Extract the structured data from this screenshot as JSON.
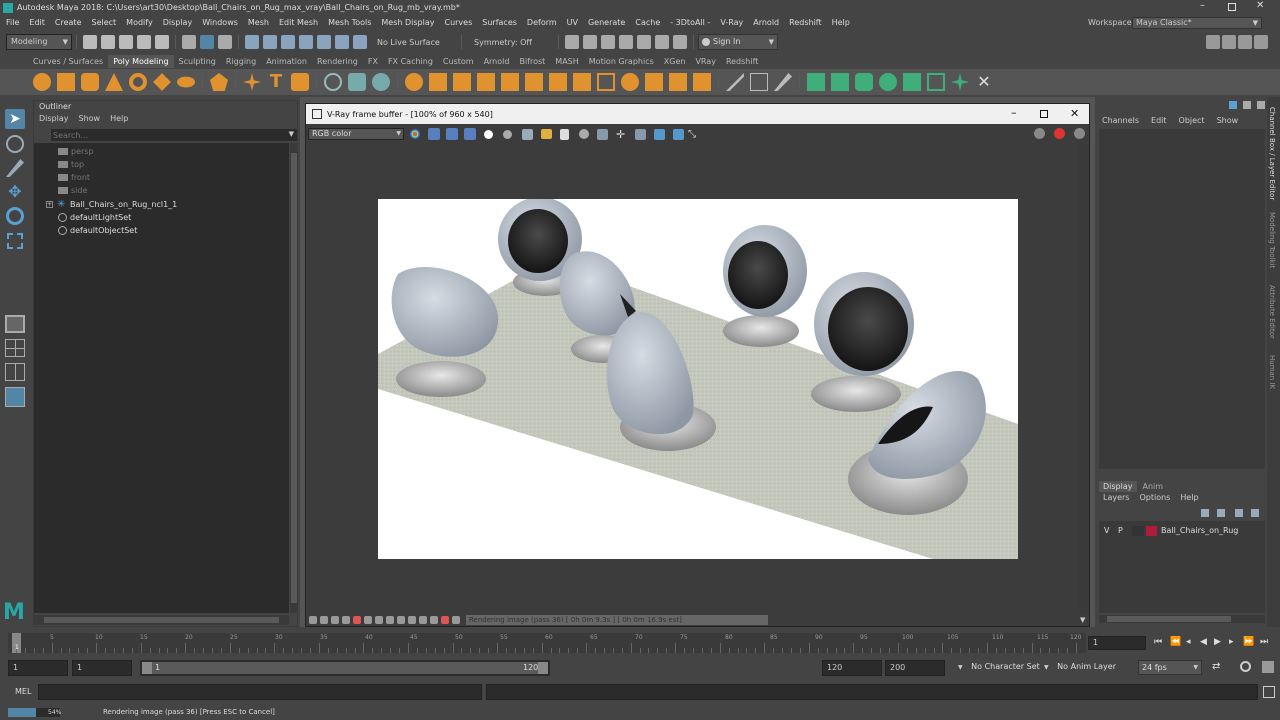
{
  "titlebar": {
    "title": "Autodesk Maya 2018: C:\\Users\\art30\\Desktop\\Ball_Chairs_on_Rug_max_vray\\Ball_Chairs_on_Rug_mb_vray.mb*"
  },
  "menubar": {
    "items": [
      "File",
      "Edit",
      "Create",
      "Select",
      "Modify",
      "Display",
      "Windows",
      "Mesh",
      "Edit Mesh",
      "Mesh Tools",
      "Mesh Display",
      "Curves",
      "Surfaces",
      "Deform",
      "UV",
      "Generate",
      "Cache",
      "- 3DtoAll -",
      "V-Ray",
      "Arnold",
      "Redshift",
      "Help"
    ],
    "workspace_label": "Workspace :",
    "workspace_value": "Maya Classic*"
  },
  "statusline": {
    "mode": "Modeling",
    "live_surface": "No Live Surface",
    "symmetry": "Symmetry: Off",
    "sign_in": "Sign In"
  },
  "shelf": {
    "tabs": [
      "Curves / Surfaces",
      "Poly Modeling",
      "Sculpting",
      "Rigging",
      "Animation",
      "Rendering",
      "FX",
      "FX Caching",
      "Custom",
      "Arnold",
      "Bifrost",
      "MASH",
      "Motion Graphics",
      "XGen",
      "VRay",
      "Redshift"
    ],
    "active": "Poly Modeling"
  },
  "outliner": {
    "title": "Outliner",
    "menu": [
      "Display",
      "Show",
      "Help"
    ],
    "search_placeholder": "Search...",
    "items": [
      "persp",
      "top",
      "front",
      "side",
      "Ball_Chairs_on_Rug_ncl1_1",
      "defaultLightSet",
      "defaultObjectSet"
    ]
  },
  "vfb": {
    "title": "V-Ray frame buffer - [100% of 960 x 540]",
    "channel": "RGB color",
    "status": "Rendering image (pass 36) [ 0h  0m  9.3s ] [ 0h  0m 16.9s est]"
  },
  "channelbox": {
    "menu": [
      "Channels",
      "Edit",
      "Object",
      "Show"
    ],
    "side_tabs": [
      "Channel Box / Layer Editor",
      "Modeling Toolkit",
      "Attribute Editor",
      "Human IK"
    ]
  },
  "layers": {
    "tabs": [
      "Display",
      "Anim"
    ],
    "menu": [
      "Layers",
      "Options",
      "Help"
    ],
    "layer_v": "V",
    "layer_p": "P",
    "layer_name": "Ball_Chairs_on_Rug",
    "layer_color": "#b01c3a"
  },
  "timeslider": {
    "ticks": [
      "1",
      "5",
      "10",
      "15",
      "20",
      "25",
      "30",
      "35",
      "40",
      "45",
      "50",
      "55",
      "60",
      "65",
      "70",
      "75",
      "80",
      "85",
      "90",
      "95",
      "100",
      "105",
      "110",
      "115",
      "120"
    ],
    "current_frame": "1"
  },
  "rangeslider": {
    "start": "1",
    "inner_start": "1",
    "range_start": "1",
    "range_end": "120",
    "end": "120",
    "max": "200",
    "character_set": "No Character Set",
    "anim_layer": "No Anim Layer",
    "fps": "24 fps"
  },
  "commandline": {
    "lang": "MEL"
  },
  "helpline": {
    "progress_label": "54%",
    "progress": 0.54,
    "text": "Rendering image (pass 36) [Press ESC to Cancel]"
  },
  "colors": {
    "accent_blue": "#5285a6",
    "orange_icon": "#e0922e",
    "green_icon": "#3fae7a"
  }
}
